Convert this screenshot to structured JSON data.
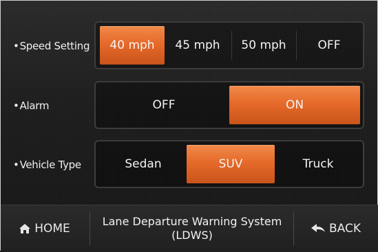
{
  "rows": {
    "speed": {
      "label": "Speed Setting",
      "options": [
        "40 mph",
        "45 mph",
        "50 mph",
        "OFF"
      ],
      "selected": "40 mph"
    },
    "alarm": {
      "label": "Alarm",
      "options": [
        "OFF",
        "ON"
      ],
      "selected": "ON"
    },
    "vehicle": {
      "label": "Vehicle Type",
      "options": [
        "Sedan",
        "SUV",
        "Truck"
      ],
      "selected": "SUV"
    }
  },
  "bottom": {
    "home_label": "HOME",
    "title_line1": "Lane Departure Warning System",
    "title_line2": "(LDWS)",
    "back_label": "BACK",
    "home_icon": "home-icon",
    "back_icon": "back-arrow-icon"
  },
  "colors": {
    "accent": "#e66a2a",
    "background": "#1c1c1c"
  }
}
